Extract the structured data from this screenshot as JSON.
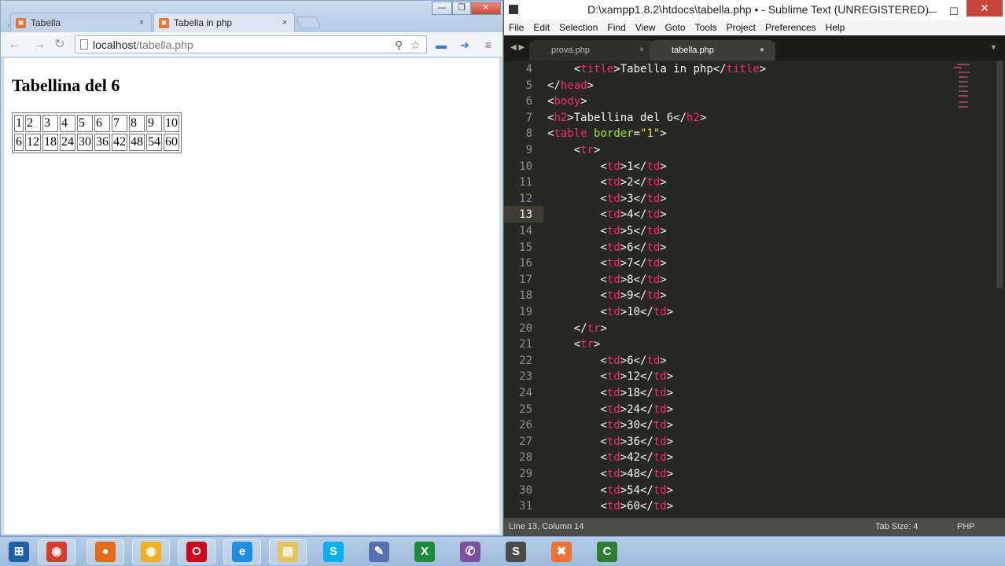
{
  "chrome": {
    "tabs": [
      {
        "label": "Tabella",
        "close": "×"
      },
      {
        "label": "Tabella in php",
        "close": "×"
      }
    ],
    "window_buttons": {
      "minimize": "—",
      "restore": "❐",
      "close": "✕"
    },
    "address": {
      "host": "localhost",
      "path": "/tabella.php"
    },
    "page": {
      "heading": "Tabellina del 6",
      "table": {
        "rows": [
          [
            "1",
            "2",
            "3",
            "4",
            "5",
            "6",
            "7",
            "8",
            "9",
            "10"
          ],
          [
            "6",
            "12",
            "18",
            "24",
            "30",
            "36",
            "42",
            "48",
            "54",
            "60"
          ]
        ]
      }
    }
  },
  "sublime": {
    "title": "D:\\xampp1.8.2\\htdocs\\tabella.php • - Sublime Text (UNREGISTERED)",
    "window_buttons": {
      "minimize": "—",
      "maximize": "☐",
      "close": "✕"
    },
    "menu": [
      "File",
      "Edit",
      "Selection",
      "Find",
      "View",
      "Goto",
      "Tools",
      "Project",
      "Preferences",
      "Help"
    ],
    "tabs": [
      {
        "label": "prova.php",
        "marker": "×"
      },
      {
        "label": "tabella.php",
        "marker": "●"
      }
    ],
    "line_numbers": [
      "4",
      "5",
      "6",
      "7",
      "8",
      "9",
      "10",
      "11",
      "12",
      "13",
      "14",
      "15",
      "16",
      "17",
      "18",
      "19",
      "20",
      "21",
      "22",
      "23",
      "24",
      "25",
      "26",
      "27",
      "28",
      "29",
      "30",
      "31"
    ],
    "current_line": "13",
    "code_lines": [
      [
        {
          "t": "    <"
        },
        {
          "t": "title",
          "c": "tg"
        },
        {
          "t": ">Tabella in php</"
        },
        {
          "t": "title",
          "c": "tg"
        },
        {
          "t": ">"
        }
      ],
      [
        {
          "t": "</"
        },
        {
          "t": "head",
          "c": "tg"
        },
        {
          "t": ">"
        }
      ],
      [
        {
          "t": "<"
        },
        {
          "t": "body",
          "c": "tg"
        },
        {
          "t": ">"
        }
      ],
      [
        {
          "t": "<"
        },
        {
          "t": "h2",
          "c": "tg"
        },
        {
          "t": ">Tabellina del 6</"
        },
        {
          "t": "h2",
          "c": "tg"
        },
        {
          "t": ">"
        }
      ],
      [
        {
          "t": "<"
        },
        {
          "t": "table",
          "c": "tg"
        },
        {
          "t": " "
        },
        {
          "t": "border",
          "c": "at"
        },
        {
          "t": "="
        },
        {
          "t": "\"1\"",
          "c": "st"
        },
        {
          "t": ">"
        }
      ],
      [
        {
          "t": "    <"
        },
        {
          "t": "tr",
          "c": "tg"
        },
        {
          "t": ">"
        }
      ],
      [
        {
          "t": "        <"
        },
        {
          "t": "td",
          "c": "tg"
        },
        {
          "t": ">1</"
        },
        {
          "t": "td",
          "c": "tg"
        },
        {
          "t": ">"
        }
      ],
      [
        {
          "t": "        <"
        },
        {
          "t": "td",
          "c": "tg"
        },
        {
          "t": ">2</"
        },
        {
          "t": "td",
          "c": "tg"
        },
        {
          "t": ">"
        }
      ],
      [
        {
          "t": "        <"
        },
        {
          "t": "td",
          "c": "tg"
        },
        {
          "t": ">3</"
        },
        {
          "t": "td",
          "c": "tg"
        },
        {
          "t": ">"
        }
      ],
      [
        {
          "t": "        <"
        },
        {
          "t": "td",
          "c": "tg"
        },
        {
          "t": ">4</"
        },
        {
          "t": "td",
          "c": "tg"
        },
        {
          "t": ">"
        }
      ],
      [
        {
          "t": "        <"
        },
        {
          "t": "td",
          "c": "tg"
        },
        {
          "t": ">5</"
        },
        {
          "t": "td",
          "c": "tg"
        },
        {
          "t": ">"
        }
      ],
      [
        {
          "t": "        <"
        },
        {
          "t": "td",
          "c": "tg"
        },
        {
          "t": ">6</"
        },
        {
          "t": "td",
          "c": "tg"
        },
        {
          "t": ">"
        }
      ],
      [
        {
          "t": "        <"
        },
        {
          "t": "td",
          "c": "tg"
        },
        {
          "t": ">7</"
        },
        {
          "t": "td",
          "c": "tg"
        },
        {
          "t": ">"
        }
      ],
      [
        {
          "t": "        <"
        },
        {
          "t": "td",
          "c": "tg"
        },
        {
          "t": ">8</"
        },
        {
          "t": "td",
          "c": "tg"
        },
        {
          "t": ">"
        }
      ],
      [
        {
          "t": "        <"
        },
        {
          "t": "td",
          "c": "tg"
        },
        {
          "t": ">9</"
        },
        {
          "t": "td",
          "c": "tg"
        },
        {
          "t": ">"
        }
      ],
      [
        {
          "t": "        <"
        },
        {
          "t": "td",
          "c": "tg"
        },
        {
          "t": ">10</"
        },
        {
          "t": "td",
          "c": "tg"
        },
        {
          "t": ">"
        }
      ],
      [
        {
          "t": "    </"
        },
        {
          "t": "tr",
          "c": "tg"
        },
        {
          "t": ">"
        }
      ],
      [
        {
          "t": "    <"
        },
        {
          "t": "tr",
          "c": "tg"
        },
        {
          "t": ">"
        }
      ],
      [
        {
          "t": "        <"
        },
        {
          "t": "td",
          "c": "tg"
        },
        {
          "t": ">6</"
        },
        {
          "t": "td",
          "c": "tg"
        },
        {
          "t": ">"
        }
      ],
      [
        {
          "t": "        <"
        },
        {
          "t": "td",
          "c": "tg"
        },
        {
          "t": ">12</"
        },
        {
          "t": "td",
          "c": "tg"
        },
        {
          "t": ">"
        }
      ],
      [
        {
          "t": "        <"
        },
        {
          "t": "td",
          "c": "tg"
        },
        {
          "t": ">18</"
        },
        {
          "t": "td",
          "c": "tg"
        },
        {
          "t": ">"
        }
      ],
      [
        {
          "t": "        <"
        },
        {
          "t": "td",
          "c": "tg"
        },
        {
          "t": ">24</"
        },
        {
          "t": "td",
          "c": "tg"
        },
        {
          "t": ">"
        }
      ],
      [
        {
          "t": "        <"
        },
        {
          "t": "td",
          "c": "tg"
        },
        {
          "t": ">30</"
        },
        {
          "t": "td",
          "c": "tg"
        },
        {
          "t": ">"
        }
      ],
      [
        {
          "t": "        <"
        },
        {
          "t": "td",
          "c": "tg"
        },
        {
          "t": ">36</"
        },
        {
          "t": "td",
          "c": "tg"
        },
        {
          "t": ">"
        }
      ],
      [
        {
          "t": "        <"
        },
        {
          "t": "td",
          "c": "tg"
        },
        {
          "t": ">42</"
        },
        {
          "t": "td",
          "c": "tg"
        },
        {
          "t": ">"
        }
      ],
      [
        {
          "t": "        <"
        },
        {
          "t": "td",
          "c": "tg"
        },
        {
          "t": ">48</"
        },
        {
          "t": "td",
          "c": "tg"
        },
        {
          "t": ">"
        }
      ],
      [
        {
          "t": "        <"
        },
        {
          "t": "td",
          "c": "tg"
        },
        {
          "t": ">54</"
        },
        {
          "t": "td",
          "c": "tg"
        },
        {
          "t": ">"
        }
      ],
      [
        {
          "t": "        <"
        },
        {
          "t": "td",
          "c": "tg"
        },
        {
          "t": ">60</"
        },
        {
          "t": "td",
          "c": "tg"
        },
        {
          "t": ">"
        }
      ]
    ],
    "status": {
      "position": "Line 13, Column 14",
      "tab_size": "Tab Size: 4",
      "syntax": "PHP"
    }
  },
  "taskbar": {
    "items": [
      {
        "name": "windows-start-icon",
        "glyph": "⊞",
        "color": "#1f5fa8"
      },
      {
        "name": "chrome-icon",
        "glyph": "◉",
        "color": "#d93a2b"
      },
      {
        "name": "firefox-icon",
        "glyph": "●",
        "color": "#e66a17"
      },
      {
        "name": "chrome-canary-icon",
        "glyph": "◉",
        "color": "#f2b01e"
      },
      {
        "name": "opera-icon",
        "glyph": "O",
        "color": "#d0021b"
      },
      {
        "name": "internet-explorer-icon",
        "glyph": "e",
        "color": "#1e90e0"
      },
      {
        "name": "file-explorer-icon",
        "glyph": "▤",
        "color": "#e8c25a"
      },
      {
        "name": "skype-icon",
        "glyph": "S",
        "color": "#00aff0"
      },
      {
        "name": "paint-icon",
        "glyph": "✎",
        "color": "#5a6fb0"
      },
      {
        "name": "excel-icon",
        "glyph": "X",
        "color": "#1d8a3a"
      },
      {
        "name": "viber-icon",
        "glyph": "✆",
        "color": "#7b519d"
      },
      {
        "name": "sublime-text-icon",
        "glyph": "S",
        "color": "#4a4a4a"
      },
      {
        "name": "xampp-icon",
        "glyph": "✖",
        "color": "#f07233"
      },
      {
        "name": "camtasia-icon",
        "glyph": "C",
        "color": "#2f7d32"
      }
    ]
  }
}
